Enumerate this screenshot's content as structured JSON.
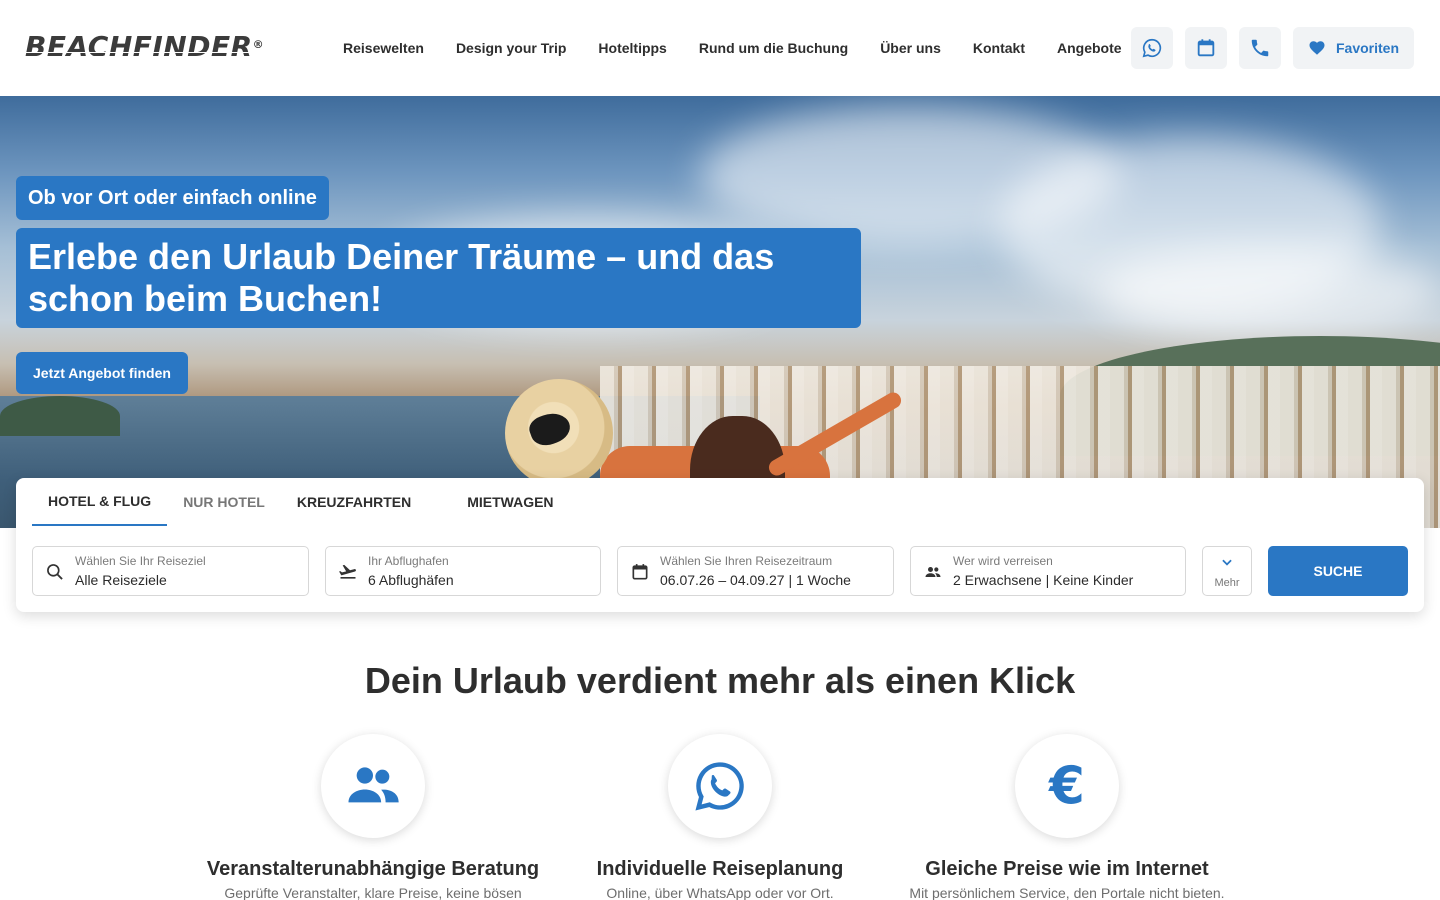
{
  "brand": {
    "name": "BEACHFINDER",
    "reg": "®"
  },
  "nav": [
    "Reisewelten",
    "Design your Trip",
    "Hoteltipps",
    "Rund um die Buchung",
    "Über uns",
    "Kontakt",
    "Angebote"
  ],
  "header_actions": {
    "whatsapp": "whatsapp-icon",
    "calendar": "calendar-icon",
    "phone": "phone-icon",
    "favorites_label": "Favoriten"
  },
  "hero": {
    "kicker": "Ob vor Ort oder einfach online",
    "title": "Erlebe den Urlaub Deiner Träume – und das schon beim Buchen!",
    "cta": "Jetzt Angebot finden"
  },
  "search": {
    "tabs": [
      "HOTEL & FLUG",
      "NUR HOTEL",
      "KREUZFAHRTEN",
      "MIETWAGEN"
    ],
    "active_tab": "HOTEL & FLUG",
    "destination": {
      "label": "Wählen Sie Ihr Reiseziel",
      "value": "Alle Reiseziele"
    },
    "airport": {
      "label": "Ihr Abflughafen",
      "value": "6 Abflughäfen"
    },
    "dates": {
      "label": "Wählen Sie Ihren Reisezeitraum",
      "value": "06.07.26 – 04.09.27 | 1 Woche"
    },
    "travellers": {
      "label": "Wer wird verreisen",
      "value": "2 Erwachsene | Keine Kinder"
    },
    "more_label": "Mehr",
    "submit": "SUCHE"
  },
  "section": {
    "title": "Dein Urlaub verdient mehr als einen Klick",
    "features": [
      {
        "icon": "people-icon",
        "title": "Veranstalterunabhängige Beratung",
        "text": "Geprüfte Veranstalter, klare Preise, keine bösen"
      },
      {
        "icon": "whatsapp-icon",
        "title": "Individuelle Reiseplanung",
        "text": "Online, über WhatsApp oder vor Ort."
      },
      {
        "icon": "euro-icon",
        "title": "Gleiche Preise wie im Internet",
        "text": "Mit persönlichem Service, den Portale nicht bieten."
      }
    ]
  },
  "colors": {
    "accent": "#2a77c4",
    "text": "#2e2e2e"
  }
}
